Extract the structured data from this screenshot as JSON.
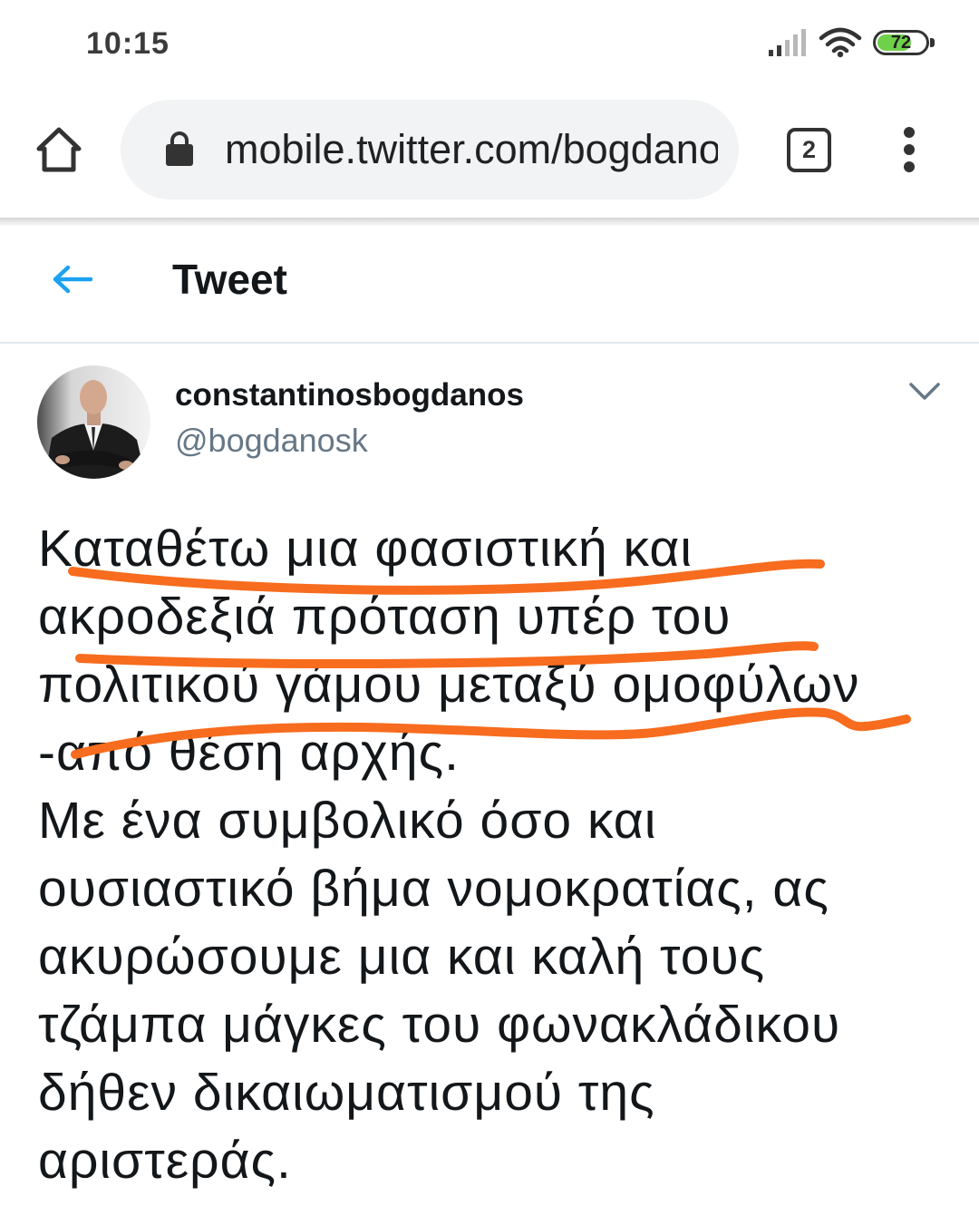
{
  "status_bar": {
    "time": "10:15",
    "battery_level": "72",
    "icons": [
      "signal-icon",
      "wifi-icon",
      "battery-icon"
    ]
  },
  "browser": {
    "url": "mobile.twitter.com/bogdano",
    "tab_count": "2",
    "icons": [
      "home-icon",
      "lock-icon",
      "tab-switcher-icon",
      "more-vert-icon"
    ]
  },
  "header": {
    "title": "Tweet",
    "icons": [
      "arrow-left-icon"
    ]
  },
  "tweet": {
    "author": {
      "name": "constantinosbogdanos",
      "handle": "@bogdanosk"
    },
    "icons": [
      "chevron-down-icon"
    ],
    "lines": [
      "Καταθέτω μια φασιστική και",
      "ακροδεξιά πρόταση υπέρ του",
      "πολιτικού γάμου μεταξύ ομοφύλων",
      "-από θέση αρχής.",
      "Με ένα συμβολικό όσο και",
      "ουσιαστικό βήμα νομοκρατίας, ας",
      "ακυρώσουμε μια και καλή τους",
      "τζάμπα μάγκες του φωνακλάδικου",
      "δήθεν δικαιωματισμού της",
      "αριστεράς."
    ]
  },
  "annotations": {
    "stroke_color": "#f76c1e"
  },
  "colors": {
    "accent": "#1da1f2",
    "handle": "#657786",
    "battery_fill": "#6fd04a",
    "url_bar_bg": "#f1f3f4",
    "text": "#14171a"
  }
}
